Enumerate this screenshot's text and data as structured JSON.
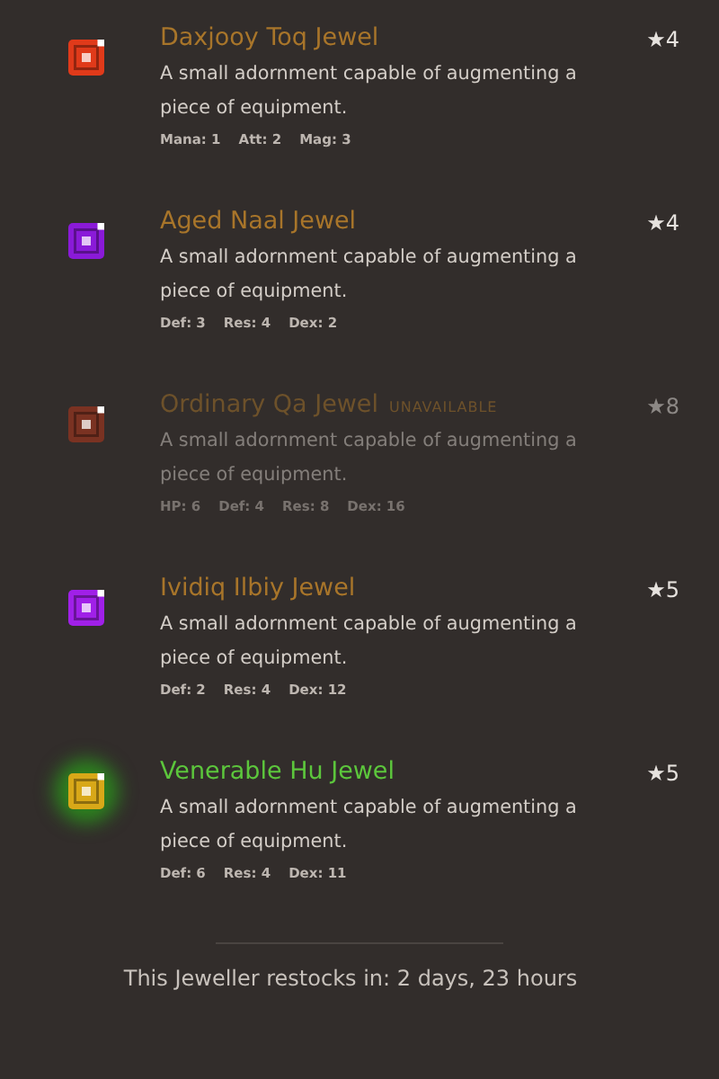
{
  "items": [
    {
      "name": "Daxjooy Toq Jewel",
      "kind": "uncommon",
      "color": "#e03a1a",
      "available": true,
      "rating": "★4",
      "description": "A small adornment capable of augmenting a piece of equipment.",
      "stats": [
        "Mana: 1",
        "Att: 2",
        "Mag: 3"
      ]
    },
    {
      "name": "Aged Naal Jewel",
      "kind": "uncommon",
      "color": "#8a1ad8",
      "available": true,
      "rating": "★4",
      "description": "A small adornment capable of augmenting a piece of equipment.",
      "stats": [
        "Def: 3",
        "Res: 4",
        "Dex: 2"
      ]
    },
    {
      "name": "Ordinary Qa Jewel",
      "kind": "uncommon",
      "color": "#7a3222",
      "available": false,
      "tag": "UNAVAILABLE",
      "rating": "★8",
      "description": "A small adornment capable of augmenting a piece of equipment.",
      "stats": [
        "HP: 6",
        "Def: 4",
        "Res: 8",
        "Dex: 16"
      ]
    },
    {
      "name": "Ividiq Ilbiy Jewel",
      "kind": "uncommon",
      "color": "#a020e8",
      "available": true,
      "rating": "★5",
      "description": "A small adornment capable of augmenting a piece of equipment.",
      "stats": [
        "Def: 2",
        "Res: 4",
        "Dex: 12"
      ]
    },
    {
      "name": "Venerable Hu Jewel",
      "kind": "rare",
      "color": "#d8a818",
      "available": true,
      "rating": "★5",
      "description": "A small adornment capable of augmenting a piece of equipment.",
      "stats": [
        "Def: 6",
        "Res: 4",
        "Dex: 11"
      ]
    }
  ],
  "restock": "This Jeweller restocks in: 2 days, 23 hours"
}
